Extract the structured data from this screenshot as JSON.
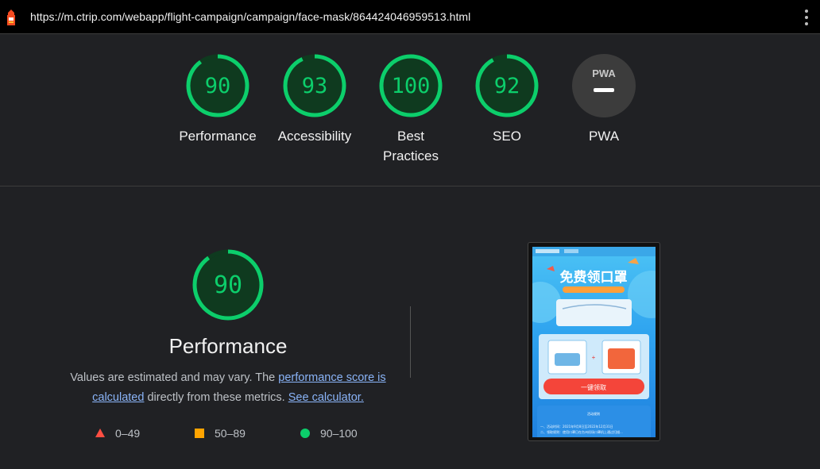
{
  "url_bar": {
    "url": "https://m.ctrip.com/webapp/flight-campaign/campaign/face-mask/864424046959513.html"
  },
  "colors": {
    "pass": "#0cce6b",
    "average": "#ffa400",
    "fail": "#ff4e42",
    "gauge_fill": "#0f3a1f",
    "pwa_bg": "#3c3c3c",
    "background": "#202124"
  },
  "categories": [
    {
      "score": "90",
      "label_line1": "Performance",
      "label_line2": ""
    },
    {
      "score": "93",
      "label_line1": "Accessibility",
      "label_line2": ""
    },
    {
      "score": "100",
      "label_line1": "Best",
      "label_line2": "Practices"
    },
    {
      "score": "92",
      "label_line1": "SEO",
      "label_line2": ""
    }
  ],
  "pwa": {
    "badge_text": "PWA",
    "label": "PWA"
  },
  "performance": {
    "score": "90",
    "title": "Performance",
    "desc_prefix": "Values are estimated and may vary. The ",
    "desc_link1": "performance score is calculated",
    "desc_middle": " directly from these metrics. ",
    "desc_link2": "See calculator."
  },
  "legend": [
    {
      "range": "0–49",
      "icon": "triangle-icon"
    },
    {
      "range": "50–89",
      "icon": "square-icon"
    },
    {
      "range": "90–100",
      "icon": "circle-icon"
    }
  ],
  "thumbnail": {
    "banner_text": "免费领口罩",
    "button_text": "一键领取",
    "section_title": "活动规则",
    "rule_1": "一、活动时间：2021年9月8日至2022年12月31日",
    "rule_2": "二、领取规则：使用口罩日在台州机场口罩机上通过扫描..."
  }
}
